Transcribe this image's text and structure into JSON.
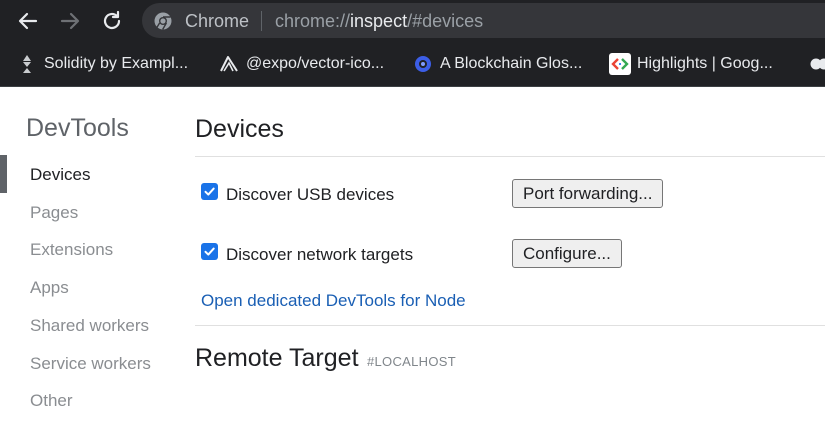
{
  "browser": {
    "site_name": "Chrome",
    "url_scheme": "chrome://",
    "url_host": "inspect",
    "url_path": "/#devices"
  },
  "bookmarks": [
    {
      "label": "Solidity by Exampl...",
      "icon": "solidity-icon"
    },
    {
      "label": "@expo/vector-ico...",
      "icon": "expo-icon"
    },
    {
      "label": "A Blockchain Glos...",
      "icon": "blockchain-icon"
    },
    {
      "label": "Highlights  |  Goog...",
      "icon": "google-icon"
    }
  ],
  "sidebar": {
    "title": "DevTools",
    "items": [
      {
        "label": "Devices",
        "active": true
      },
      {
        "label": "Pages"
      },
      {
        "label": "Extensions"
      },
      {
        "label": "Apps"
      },
      {
        "label": "Shared workers"
      },
      {
        "label": "Service workers"
      },
      {
        "label": "Other"
      }
    ]
  },
  "main": {
    "title": "Devices",
    "usb": {
      "label": "Discover USB devices",
      "checked": true,
      "button": "Port forwarding..."
    },
    "network": {
      "label": "Discover network targets",
      "checked": true,
      "button": "Configure..."
    },
    "node_link": "Open dedicated DevTools for Node",
    "remote_title": "Remote Target",
    "remote_sub": "#LOCALHOST"
  },
  "colors": {
    "accent": "#1a73e8",
    "link": "#1a5fb4",
    "toolbar": "#202124"
  }
}
